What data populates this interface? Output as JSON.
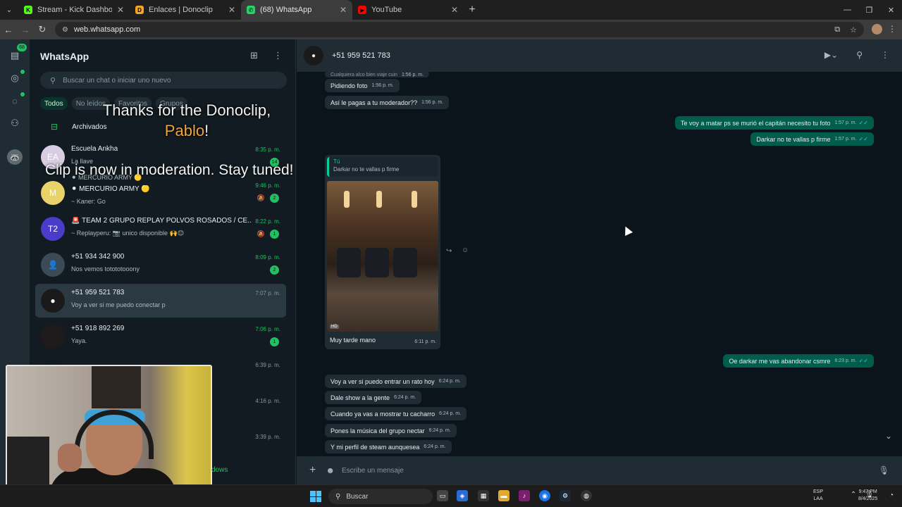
{
  "browser": {
    "tabs": [
      {
        "title": "Stream - Kick Dashboard",
        "icon": "kick-icon",
        "color": "#53fc18"
      },
      {
        "title": "Enlaces | Donoclip",
        "icon": "donoclip-icon",
        "color": "#f5a623"
      },
      {
        "title": "(68) WhatsApp",
        "icon": "whatsapp-icon",
        "color": "#25d366",
        "active": true
      },
      {
        "title": "YouTube",
        "icon": "youtube-icon",
        "color": "#ff0000"
      }
    ],
    "url": "web.whatsapp.com"
  },
  "rail": {
    "chats_badge": "68"
  },
  "sidebar": {
    "title": "WhatsApp",
    "search_placeholder": "Buscar un chat o iniciar uno nuevo",
    "filters": [
      "Todos",
      "No leídos",
      "Favoritos",
      "Grupos"
    ],
    "archived_label": "Archivados",
    "chats": [
      {
        "name": "Escuela Ankha",
        "preview": "La llave",
        "time": "8:35 p. m.",
        "badge": "14",
        "avatar_color": "#d9cde3",
        "avatar_text": "EA"
      },
      {
        "prehead": "⚫ MERCURIO ARMY 🟡",
        "name": "⚫ MERCURIO ARMY 🟡",
        "preview": "~ Kaner: Go",
        "time": "9:46 p. m.",
        "badge": "2",
        "muted": true,
        "avatar_color": "#e8d26a",
        "avatar_text": "M"
      },
      {
        "name": "🚨 TEAM 2 GRUPO REPLAY POLVOS ROSADOS / CE...",
        "preview": "~ Replayperu: 📷 unico disponible 🙌😊",
        "time": "8:22 p. m.",
        "badge": "1",
        "muted": true,
        "avatar_color": "#4b3bc9",
        "avatar_text": "T2"
      },
      {
        "name": "+51 934 342 900",
        "preview": "Nos vemos totototooony",
        "time": "8:09 p. m.",
        "badge": "2",
        "avatar_color": "#3b4a54",
        "avatar_text": "👤"
      },
      {
        "name": "+51 959 521 783",
        "preview": "Voy a ver si me puedo conectar p",
        "time": "7:07 p. m.",
        "selected": true,
        "avatar_color": "#1a1a1a",
        "avatar_text": "●"
      },
      {
        "name": "+51 918 892 269",
        "preview": "Yaya.",
        "time": "7:06 p. m.",
        "badge": "1",
        "avatar_color": "#1f1a1c",
        "avatar_text": ""
      },
      {
        "name": "",
        "preview": "",
        "time": "6:39 p. m.",
        "avatar_color": "#111b21",
        "avatar_text": ""
      },
      {
        "name": "",
        "preview": "",
        "time": "4:16 p. m.",
        "avatar_color": "#111b21",
        "avatar_text": ""
      },
      {
        "name": "",
        "preview": "",
        "time": "3:39 p. m.",
        "avatar_color": "#111b21",
        "avatar_text": ""
      }
    ]
  },
  "overlay": {
    "line1": "Thanks for the Donoclip,",
    "name": "Pablo",
    "bang": "!",
    "line2": "Clip is now in moderation. Stay tuned!"
  },
  "webcam_tail_text": "dows",
  "conversation": {
    "contact": "+51 959 521 783",
    "messages": [
      {
        "dir": "in",
        "cut": true,
        "text": "Cualquiera alco bien viaje cuin",
        "time": "1:56 p. m."
      },
      {
        "dir": "in",
        "text": "Pidiendo foto",
        "time": "1:56 p. m."
      },
      {
        "dir": "in",
        "text": "Así le pagas a tu moderador??",
        "time": "1:56 p. m."
      },
      {
        "dir": "out",
        "text": "Te voy a matar ps se murió el capitán necesito tu foto",
        "time": "1:57 p. m."
      },
      {
        "dir": "out",
        "text": "Darkar no te vallas p firme",
        "time": "1:57 p. m."
      },
      {
        "dir": "out",
        "text": "Oe darkar me vas abandonar csmre",
        "time": "6:23 p. m."
      },
      {
        "dir": "in",
        "text": "Voy a ver si puedo entrar un rato hoy",
        "time": "6:24 p. m."
      },
      {
        "dir": "in",
        "text": "Dale show a la gente",
        "time": "6:24 p. m."
      },
      {
        "dir": "in",
        "text": "Cuando ya vas a mostrar tu cacharro",
        "time": "6:24 p. m."
      },
      {
        "dir": "in",
        "text": "Pones la música del grupo nectar",
        "time": "6:24 p. m."
      },
      {
        "dir": "in",
        "text": "Y mi perfil de steam aunquesea",
        "time": "6:24 p. m."
      }
    ],
    "image_message": {
      "quote_author": "Tú",
      "quote_text": "Darkar no te vallas p firme",
      "badge": "HD",
      "caption": "Muy tarde mano",
      "time": "6:11 p. m."
    },
    "composer_placeholder": "Escribe un mensaje"
  },
  "taskbar": {
    "search_label": "Buscar",
    "lang_top": "ESP",
    "lang_bottom": "LAA",
    "time": "9:47 PM",
    "date": "8/4/2025"
  }
}
